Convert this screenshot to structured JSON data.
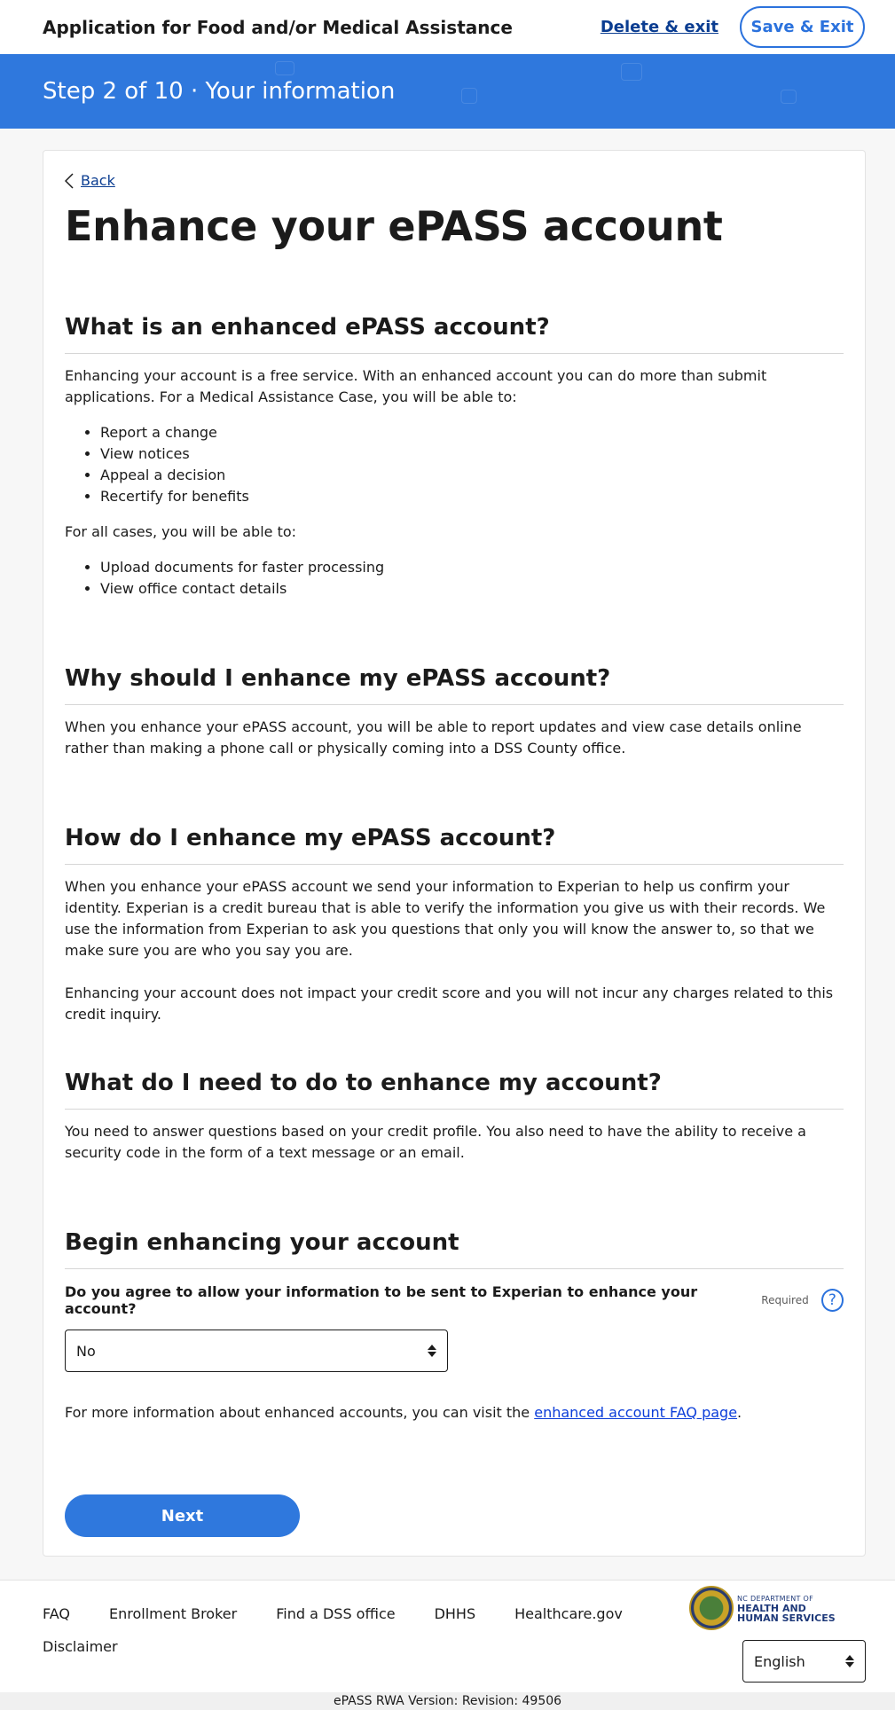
{
  "header": {
    "app_title": "Application for Food and/or Medical Assistance",
    "delete_exit": "Delete & exit",
    "save_exit": "Save & Exit"
  },
  "stepbar": {
    "step_text": "Step 2 of 10 · Your information"
  },
  "main": {
    "back": "Back",
    "page_title": "Enhance your ePASS account",
    "sections": [
      {
        "heading": "What is an enhanced ePASS account?",
        "intro": "Enhancing your account is a free service. With an enhanced account you can do more than submit applications. For a Medical Assistance Case, you will be able to:",
        "list1": [
          "Report a change",
          "View notices",
          "Appeal a decision",
          "Recertify for benefits"
        ],
        "all_cases": "For all cases, you will be able to:",
        "list2": [
          "Upload documents for faster processing",
          "View office contact details"
        ]
      },
      {
        "heading": "Why should I enhance my ePASS account?",
        "body": "When you enhance your ePASS account, you will be able to report updates and view case details online rather than making a phone call or physically coming into a DSS County office."
      },
      {
        "heading": "How do I enhance my ePASS account?",
        "body1": "When you enhance your ePASS account we send your information to Experian to help us confirm your identity. Experian is a credit bureau that is able to verify the information you give us with their records. We use the information from Experian to ask you questions that only you will know the answer to, so that we make sure you are who you say you are.",
        "body2": "Enhancing your account does not impact your credit score and you will not incur any charges related to this credit inquiry."
      },
      {
        "heading": "What do I need to do to enhance my account?",
        "body": "You need to answer questions based on your credit profile. You also need to have the ability to receive a security code in the form of a text message or an email."
      },
      {
        "heading": "Begin enhancing your account",
        "question": "Do you agree to allow your information to be sent to Experian to enhance your account?",
        "required": "Required",
        "help_icon": "?",
        "selected": "No"
      }
    ],
    "faq_prefix": "For more information about enhanced accounts, you can visit the ",
    "faq_link": "enhanced account FAQ page",
    "faq_suffix": ".",
    "next": "Next"
  },
  "footer": {
    "links": [
      "FAQ",
      "Enrollment Broker",
      "Find a DSS office",
      "DHHS",
      "Healthcare.gov",
      "Disclaimer"
    ],
    "logo_small": "NC DEPARTMENT OF",
    "logo_line1": "HEALTH AND",
    "logo_line2": "HUMAN SERVICES",
    "language": "English",
    "version": "ePASS RWA Version: Revision: 49506"
  },
  "colors": {
    "brand_blue": "#2f78dd",
    "link_blue": "#0b3d91"
  },
  "icons": [
    "chevron-left-icon",
    "help-icon",
    "select-arrows-icon",
    "dhhs-seal-logo"
  ]
}
